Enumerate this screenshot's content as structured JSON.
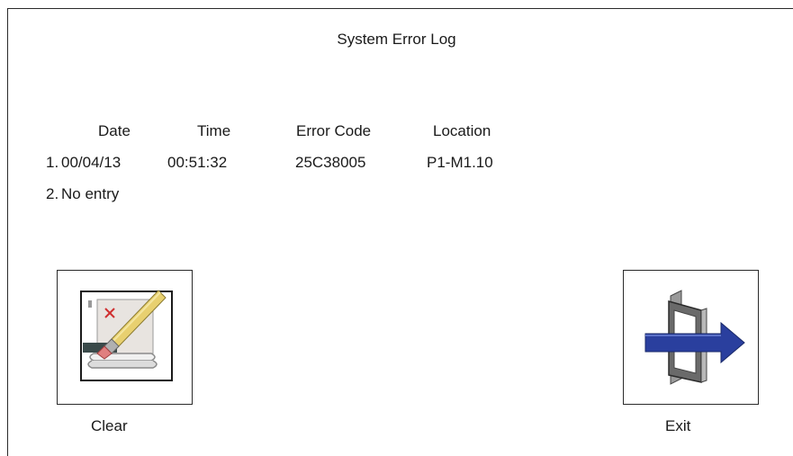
{
  "window": {
    "title": "System Error Log"
  },
  "table": {
    "headers": {
      "date": "Date",
      "time": "Time",
      "error_code": "Error Code",
      "location": "Location"
    },
    "rows": [
      {
        "index": "1.",
        "date": "00/04/13",
        "time": "00:51:32",
        "error_code": "25C38005",
        "location": "P1-M1.10"
      },
      {
        "index": "2.",
        "text": "No entry"
      }
    ]
  },
  "buttons": {
    "clear": {
      "label": "Clear",
      "icon": "clear-log-icon"
    },
    "exit": {
      "label": "Exit",
      "icon": "exit-door-icon"
    }
  },
  "colors": {
    "exit_arrow": "#2a3f9e",
    "clear_x": "#d03030",
    "border": "#2a2a2a"
  }
}
